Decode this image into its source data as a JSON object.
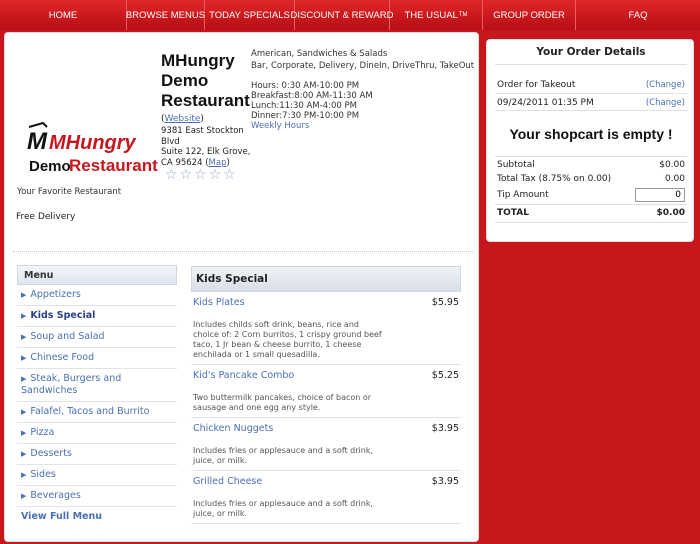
{
  "nav": [
    {
      "label": "HOME",
      "name": "nav-home"
    },
    {
      "label": "BROWSE MENUS",
      "name": "nav-browse-menus"
    },
    {
      "label": "TODAY SPECIALS",
      "name": "nav-today-specials"
    },
    {
      "label": "DISCOUNT & REWARD",
      "name": "nav-discount-reward"
    },
    {
      "label": "THE USUAL",
      "sup": "TM",
      "name": "nav-the-usual"
    },
    {
      "label": "GROUP ORDER",
      "name": "nav-group-order"
    },
    {
      "label": "FAQ",
      "name": "nav-faq"
    }
  ],
  "restaurant": {
    "name": "MHungry Demo Restaurant",
    "website_label": "Website",
    "address_line1": "9381 East Stockton Blvd",
    "address_line2": "Suite 122, Elk Grove, CA 95624",
    "map_label": "Map",
    "cuisines": "American, Sandwiches & Salads",
    "services": "Bar, Corporate, Delivery, DineIn, DriveThru, TakeOut",
    "hours": [
      "Hours: 0:30 AM-10:00 PM",
      "Breakfast:8:00 AM-11:30 AM",
      "Lunch:11:30 AM-4:00 PM",
      "Dinner:7:30 PM-10:00 PM"
    ],
    "weekly_hours_label": "Weekly Hours",
    "tagline": "Your Favorite Restaurant",
    "delivery": "Free Delivery",
    "rating": 0,
    "logo_top": "MHungry",
    "logo_bottom_1": "Demo",
    "logo_bottom_2": "Restaurant"
  },
  "menu": {
    "title": "Menu",
    "items": [
      "Appetizers",
      "Kids Special",
      "Soup and Salad",
      "Chinese Food",
      "Steak, Burgers and Sandwiches",
      "Falafel, Tacos and Burrito",
      "Pizza",
      "Desserts",
      "Sides",
      "Beverages"
    ],
    "active": "Kids Special",
    "view_full": "View Full Menu"
  },
  "category": {
    "title": "Kids Special",
    "items": [
      {
        "name": "Kids Plates",
        "price": "$5.95",
        "desc": "Includes childs soft drink, beans, rice and choice of: 2 Corn burritos, 1 crispy ground beef taco, 1 Jr bean & cheese burrito, 1 cheese enchilada or 1 small quesadilla."
      },
      {
        "name": "Kid's Pancake Combo",
        "price": "$5.25",
        "desc": "Two buttermilk pancakes, choice of bacon or sausage and one egg any style."
      },
      {
        "name": "Chicken Nuggets",
        "price": "$3.95",
        "desc": "Includes fries or applesauce and a soft drink, juice, or milk."
      },
      {
        "name": "Grilled Cheese",
        "price": "$3.95",
        "desc": "Includes fries or applesauce and a soft drink, juice, or milk."
      }
    ]
  },
  "order": {
    "title": "Your Order Details",
    "mode": "Order for Takeout",
    "datetime": "09/24/2011 01:35 PM",
    "change_label": "(Change)",
    "empty_msg": "Your shopcart is empty !",
    "subtotal_label": "Subtotal",
    "subtotal": "$0.00",
    "tax_label": "Total Tax (8.75% on 0.00)",
    "tax": "0.00",
    "tip_label": "Tip Amount",
    "tip": "0",
    "total_label": "TOTAL",
    "total": "$0.00"
  },
  "colors": {
    "brand": "#c7161c",
    "link": "#4a6fb5"
  }
}
